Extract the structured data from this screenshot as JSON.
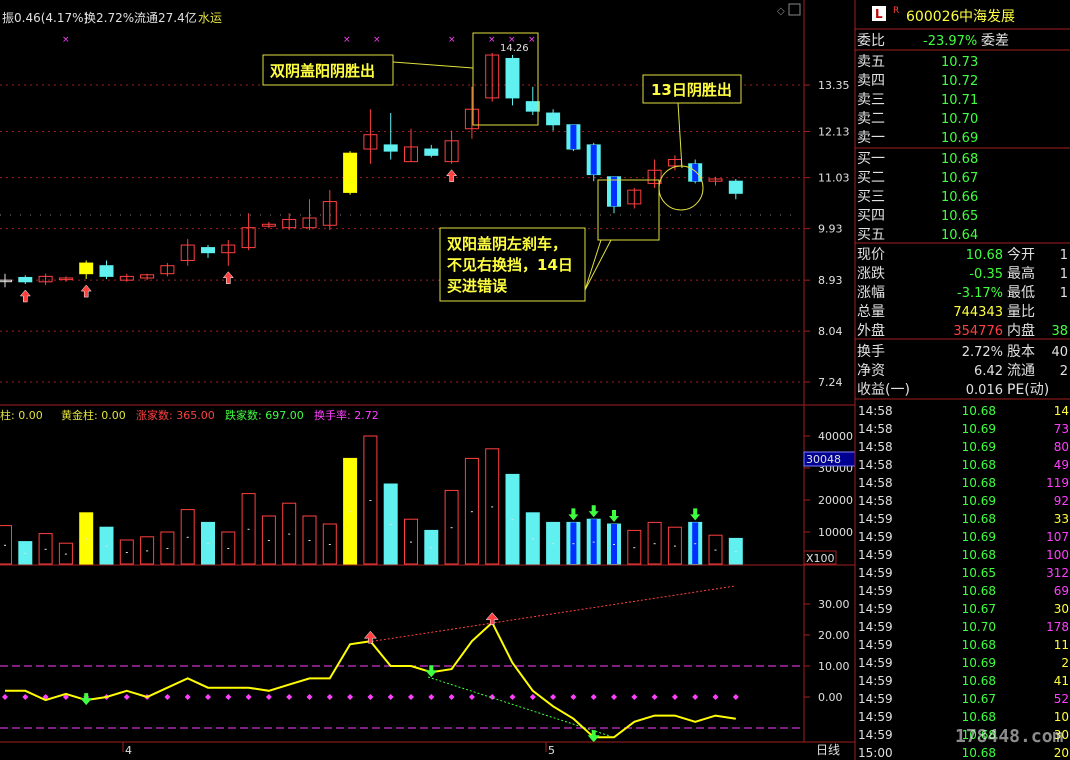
{
  "header": {
    "amplitude": "振0.46(4.17%)",
    "turnover": "换2.72%",
    "float_cap": "流通27.4亿",
    "sector": "水运"
  },
  "annotations": {
    "left_box": "双阴盖阳阴胜出",
    "right_box": "13日阴胜出",
    "bottom_box": [
      "双阳盖阴左刹车，",
      "不见右换挡，14日",
      "买进错误"
    ],
    "peak_label": "14.26"
  },
  "price_axis": {
    "ticks": [
      "13.35",
      "12.13",
      "11.03",
      "9.93",
      "8.93",
      "8.04",
      "7.24"
    ]
  },
  "indicator_bar": {
    "items": [
      {
        "label": "柱: 0.00",
        "color": "#e0e040"
      },
      {
        "label": "黄金柱: 0.00",
        "color": "#e0e040"
      },
      {
        "label": "涨家数: 365.00",
        "color": "#ff4040"
      },
      {
        "label": "跌家数: 697.00",
        "color": "#40ff40"
      },
      {
        "label": "换手率: 2.72",
        "color": "#ff40ff"
      }
    ]
  },
  "volume_axis": {
    "ticks": [
      "40000",
      "30000",
      "20000",
      "10000"
    ],
    "current": "30048",
    "multiplier": "X100"
  },
  "osc_axis": {
    "ticks": [
      "30.00",
      "20.00",
      "10.00",
      "0.00"
    ]
  },
  "date_axis": {
    "ticks": [
      "4",
      "5"
    ],
    "period": "日线"
  },
  "chart_data": {
    "type": "candlestick",
    "colors": {
      "up": "#ff4040",
      "down": "#60f0f0",
      "yellow": "#ffff00",
      "blue": "#0030ff"
    },
    "candles": [
      {
        "o": 8.93,
        "c": 8.93,
        "h": 9.05,
        "l": 8.8,
        "k": "doji"
      },
      {
        "o": 8.98,
        "c": 8.9,
        "h": 9.02,
        "l": 8.86,
        "k": "down"
      },
      {
        "o": 8.9,
        "c": 9.0,
        "h": 9.05,
        "l": 8.84,
        "k": "up"
      },
      {
        "o": 8.94,
        "c": 8.97,
        "h": 9.0,
        "l": 8.9,
        "k": "up"
      },
      {
        "o": 9.05,
        "c": 9.25,
        "h": 9.3,
        "l": 8.95,
        "k": "yellow"
      },
      {
        "o": 9.2,
        "c": 9.0,
        "h": 9.3,
        "l": 8.95,
        "k": "down"
      },
      {
        "o": 8.93,
        "c": 9.0,
        "h": 9.05,
        "l": 8.9,
        "k": "up"
      },
      {
        "o": 8.97,
        "c": 9.03,
        "h": 9.05,
        "l": 8.93,
        "k": "up"
      },
      {
        "o": 9.05,
        "c": 9.2,
        "h": 9.25,
        "l": 9.0,
        "k": "up"
      },
      {
        "o": 9.3,
        "c": 9.6,
        "h": 9.72,
        "l": 9.2,
        "k": "up"
      },
      {
        "o": 9.55,
        "c": 9.45,
        "h": 9.6,
        "l": 9.35,
        "k": "down"
      },
      {
        "o": 9.45,
        "c": 9.6,
        "h": 9.7,
        "l": 9.2,
        "k": "up"
      },
      {
        "o": 9.55,
        "c": 9.95,
        "h": 10.25,
        "l": 9.5,
        "k": "up"
      },
      {
        "o": 9.98,
        "c": 10.02,
        "h": 10.07,
        "l": 9.94,
        "k": "up"
      },
      {
        "o": 9.95,
        "c": 10.12,
        "h": 10.25,
        "l": 9.9,
        "k": "up"
      },
      {
        "o": 9.95,
        "c": 10.15,
        "h": 10.55,
        "l": 9.9,
        "k": "up"
      },
      {
        "o": 10.0,
        "c": 10.5,
        "h": 10.75,
        "l": 9.9,
        "k": "up"
      },
      {
        "o": 10.7,
        "c": 11.6,
        "h": 11.65,
        "l": 10.65,
        "k": "yellow"
      },
      {
        "o": 11.7,
        "c": 12.05,
        "h": 12.7,
        "l": 11.35,
        "k": "up"
      },
      {
        "o": 11.8,
        "c": 11.65,
        "h": 12.6,
        "l": 11.45,
        "k": "down"
      },
      {
        "o": 11.4,
        "c": 11.75,
        "h": 12.2,
        "l": 11.4,
        "k": "up"
      },
      {
        "o": 11.7,
        "c": 11.55,
        "h": 11.8,
        "l": 11.5,
        "k": "down"
      },
      {
        "o": 11.4,
        "c": 11.9,
        "h": 12.15,
        "l": 11.35,
        "k": "up"
      },
      {
        "o": 12.2,
        "c": 12.7,
        "h": 13.3,
        "l": 11.95,
        "k": "up"
      },
      {
        "o": 13.0,
        "c": 14.2,
        "h": 14.26,
        "l": 12.9,
        "k": "up"
      },
      {
        "o": 14.1,
        "c": 13.0,
        "h": 14.2,
        "l": 12.8,
        "k": "down"
      },
      {
        "o": 12.9,
        "c": 12.65,
        "h": 13.3,
        "l": 12.55,
        "k": "down"
      },
      {
        "o": 12.6,
        "c": 12.3,
        "h": 12.7,
        "l": 12.15,
        "k": "down"
      },
      {
        "o": 12.3,
        "c": 11.7,
        "h": 12.3,
        "l": 11.65,
        "k": "blue"
      },
      {
        "o": 11.8,
        "c": 11.1,
        "h": 11.85,
        "l": 10.95,
        "k": "blue"
      },
      {
        "o": 11.05,
        "c": 10.4,
        "h": 11.05,
        "l": 10.25,
        "k": "blue"
      },
      {
        "o": 10.45,
        "c": 10.75,
        "h": 10.8,
        "l": 10.35,
        "k": "up"
      },
      {
        "o": 10.9,
        "c": 11.2,
        "h": 11.45,
        "l": 10.8,
        "k": "up"
      },
      {
        "o": 11.3,
        "c": 11.45,
        "h": 11.55,
        "l": 11.2,
        "k": "up"
      },
      {
        "o": 11.35,
        "c": 10.95,
        "h": 11.45,
        "l": 10.9,
        "k": "blue"
      },
      {
        "o": 10.95,
        "c": 11.0,
        "h": 11.05,
        "l": 10.85,
        "k": "up"
      },
      {
        "o": 10.95,
        "c": 10.68,
        "h": 11.0,
        "l": 10.55,
        "k": "down"
      }
    ],
    "up_arrows": [
      1,
      4,
      11,
      22
    ],
    "volume": [
      12000,
      7000,
      9500,
      6500,
      16000,
      11500,
      7500,
      8500,
      10000,
      17000,
      13000,
      10000,
      22000,
      15000,
      19000,
      15000,
      12500,
      33000,
      40000,
      25000,
      14000,
      10500,
      23000,
      33000,
      36000,
      28000,
      16000,
      13000,
      13000,
      14000,
      12500,
      10500,
      13000,
      11500,
      13000,
      9000,
      8000
    ],
    "vol_arrows": [
      28,
      29,
      30,
      34
    ],
    "osc": [
      2,
      2,
      -1,
      1,
      -1,
      0,
      2,
      0,
      3,
      6,
      3,
      3,
      3,
      2,
      4,
      6,
      6,
      17,
      18,
      10,
      10,
      8,
      9,
      18,
      24,
      11,
      2,
      -3,
      -7,
      -13,
      -13,
      -8,
      -6,
      -6,
      -8,
      -6,
      -7
    ],
    "osc_up_arrows": [
      18,
      24
    ],
    "osc_down_arrows": [
      4,
      21,
      29
    ],
    "osc_ref_levels": [
      10,
      0,
      -10
    ]
  },
  "quote": {
    "code": "600026",
    "name": "中海发展",
    "badge_L": "L",
    "badge_R": "R",
    "weibi_label": "委比",
    "weibi_val": "-23.97%",
    "weicha_label": "委差",
    "asks": [
      {
        "label": "卖五",
        "price": "10.73"
      },
      {
        "label": "卖四",
        "price": "10.72"
      },
      {
        "label": "卖三",
        "price": "10.71"
      },
      {
        "label": "卖二",
        "price": "10.70"
      },
      {
        "label": "卖一",
        "price": "10.69"
      }
    ],
    "bids": [
      {
        "label": "买一",
        "price": "10.68"
      },
      {
        "label": "买二",
        "price": "10.67"
      },
      {
        "label": "买三",
        "price": "10.66"
      },
      {
        "label": "买四",
        "price": "10.65"
      },
      {
        "label": "买五",
        "price": "10.64"
      }
    ],
    "stats1": [
      {
        "l": "现价",
        "v": "10.68",
        "vc": "#40ff40",
        "r": "今开",
        "rv": "1",
        "rc": "#e0e0e0"
      },
      {
        "l": "涨跌",
        "v": "-0.35",
        "vc": "#40ff40",
        "r": "最高",
        "rv": "1",
        "rc": "#e0e0e0"
      },
      {
        "l": "涨幅",
        "v": "-3.17%",
        "vc": "#40ff40",
        "r": "最低",
        "rv": "1",
        "rc": "#e0e0e0"
      },
      {
        "l": "总量",
        "v": "744343",
        "vc": "#ffff40",
        "r": "量比",
        "rv": "",
        "rc": "#e0e0e0"
      },
      {
        "l": "外盘",
        "v": "354776",
        "vc": "#ff4040",
        "r": "内盘",
        "rv": "38",
        "rc": "#40ff40"
      }
    ],
    "stats2": [
      {
        "l": "换手",
        "v": "2.72%",
        "vc": "#e0e0e0",
        "r": "股本",
        "rv": "40",
        "rc": "#e0e0e0"
      },
      {
        "l": "净资",
        "v": "6.42",
        "vc": "#e0e0e0",
        "r": "流通",
        "rv": "2",
        "rc": "#e0e0e0"
      },
      {
        "l": "收益(一)",
        "v": "0.016",
        "vc": "#e0e0e0",
        "r": "PE(动)",
        "rv": "",
        "rc": "#e0e0e0"
      }
    ],
    "ticks": [
      {
        "t": "14:58",
        "p": "10.68",
        "v": "14",
        "vc": "#ffff40"
      },
      {
        "t": "14:58",
        "p": "10.69",
        "v": "73",
        "vc": "#ff40ff"
      },
      {
        "t": "14:58",
        "p": "10.69",
        "v": "80",
        "vc": "#ff40ff"
      },
      {
        "t": "14:58",
        "p": "10.68",
        "v": "49",
        "vc": "#ff40ff"
      },
      {
        "t": "14:58",
        "p": "10.68",
        "v": "119",
        "vc": "#ff40ff"
      },
      {
        "t": "14:58",
        "p": "10.69",
        "v": "92",
        "vc": "#ff40ff"
      },
      {
        "t": "14:59",
        "p": "10.68",
        "v": "33",
        "vc": "#ffff40"
      },
      {
        "t": "14:59",
        "p": "10.69",
        "v": "107",
        "vc": "#ff40ff"
      },
      {
        "t": "14:59",
        "p": "10.68",
        "v": "100",
        "vc": "#ff40ff"
      },
      {
        "t": "14:59",
        "p": "10.65",
        "v": "312",
        "vc": "#ff40ff"
      },
      {
        "t": "14:59",
        "p": "10.68",
        "v": "69",
        "vc": "#ff40ff"
      },
      {
        "t": "14:59",
        "p": "10.67",
        "v": "30",
        "vc": "#ffff40"
      },
      {
        "t": "14:59",
        "p": "10.70",
        "v": "178",
        "vc": "#ff40ff"
      },
      {
        "t": "14:59",
        "p": "10.68",
        "v": "11",
        "vc": "#ffff40"
      },
      {
        "t": "14:59",
        "p": "10.69",
        "v": "2",
        "vc": "#ffff40"
      },
      {
        "t": "14:59",
        "p": "10.68",
        "v": "41",
        "vc": "#ffff40"
      },
      {
        "t": "14:59",
        "p": "10.67",
        "v": "52",
        "vc": "#ff40ff"
      },
      {
        "t": "14:59",
        "p": "10.68",
        "v": "10",
        "vc": "#ffff40"
      },
      {
        "t": "14:59",
        "p": "10.68",
        "v": "30",
        "vc": "#ffff40"
      },
      {
        "t": "15:00",
        "p": "10.68",
        "v": "20",
        "vc": "#ffff40"
      }
    ]
  },
  "watermark": "178448.com"
}
